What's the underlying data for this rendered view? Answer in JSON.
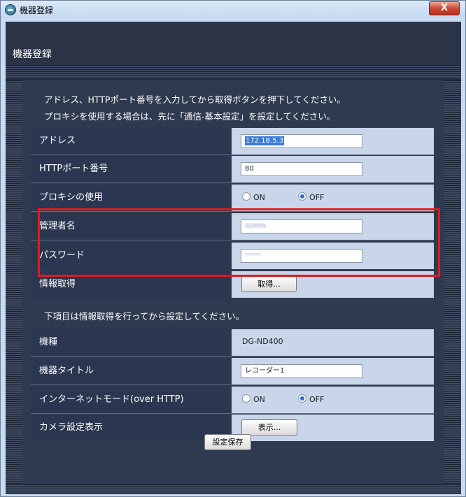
{
  "window": {
    "title": "機器登録",
    "close_label": "X"
  },
  "header": {
    "title": "機器登録"
  },
  "instructions": {
    "line1": "アドレス、HTTPポート番号を入力してから取得ボタンを押下してください。",
    "line2": "プロキシを使用する場合は、先に「通信-基本設定」を設定してください。",
    "line3": "下項目は情報取得を行ってから設定してください。"
  },
  "form": {
    "address": {
      "label": "アドレス",
      "value": "172.18.5.3"
    },
    "http_port": {
      "label": "HTTPポート番号",
      "value": "80"
    },
    "proxy": {
      "label": "プロキシの使用",
      "option_on": "ON",
      "option_off": "OFF",
      "selected": "OFF"
    },
    "admin_name": {
      "label": "管理者名",
      "value": "ADMIN"
    },
    "password": {
      "label": "パスワード",
      "value": "*****"
    },
    "info_fetch": {
      "label": "情報取得",
      "button": "取得..."
    },
    "model": {
      "label": "機種",
      "value": "DG-ND400"
    },
    "device_title": {
      "label": "機器タイトル",
      "value": "レコーダー1"
    },
    "internet_mode": {
      "label": "インターネットモード(over HTTP)",
      "option_on": "ON",
      "option_off": "OFF",
      "selected": "OFF"
    },
    "camera_settings": {
      "label": "カメラ設定表示",
      "button": "表示..."
    }
  },
  "save_button": "設定保存",
  "colors": {
    "highlight": "#e01b1b",
    "panel": "#2e3a4f",
    "value_bg": "#c9d6ea"
  }
}
